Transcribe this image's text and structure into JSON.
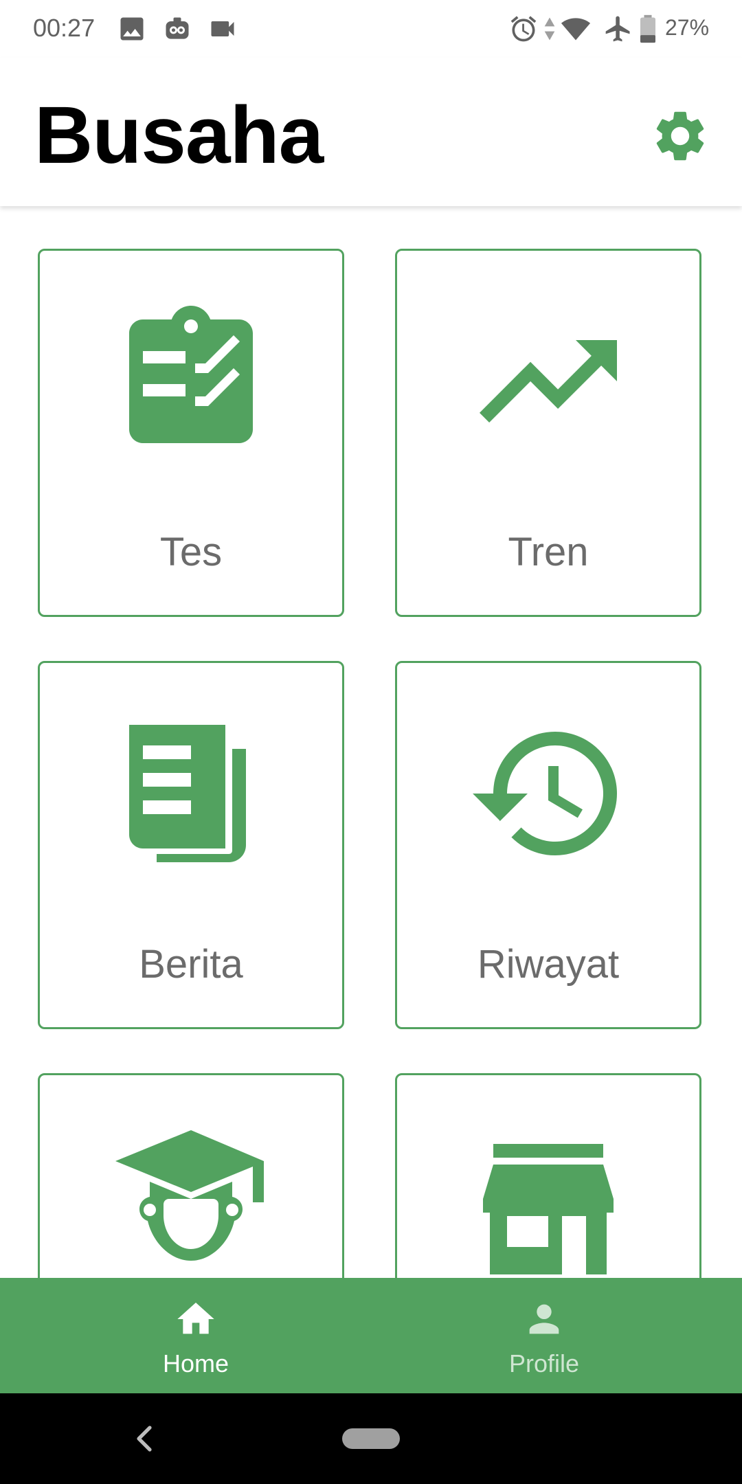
{
  "status_bar": {
    "time": "00:27",
    "left_icons": [
      "image-icon",
      "owl-app-icon",
      "video-camera-icon"
    ],
    "right_icons": [
      "alarm-icon",
      "data-arrows-icon",
      "wifi-icon",
      "airplane-icon",
      "battery-icon"
    ],
    "battery": "27%"
  },
  "app_bar": {
    "title": "Busaha",
    "settings_icon": "gear-icon"
  },
  "grid": {
    "items": [
      {
        "label": "Tes",
        "icon": "clipboard-checklist-icon"
      },
      {
        "label": "Tren",
        "icon": "trending-up-icon"
      },
      {
        "label": "Berita",
        "icon": "newspaper-icon"
      },
      {
        "label": "Riwayat",
        "icon": "history-icon"
      },
      {
        "label": "",
        "icon": "graduate-icon"
      },
      {
        "label": "",
        "icon": "store-icon"
      }
    ]
  },
  "bottom_nav": {
    "items": [
      {
        "label": "Home",
        "icon": "home-icon",
        "active": true
      },
      {
        "label": "Profile",
        "icon": "person-icon",
        "active": false
      }
    ]
  },
  "colors": {
    "accent": "#52a25f",
    "label_gray": "#6b6b6b",
    "nav_inactive": "#cfe6d2"
  }
}
